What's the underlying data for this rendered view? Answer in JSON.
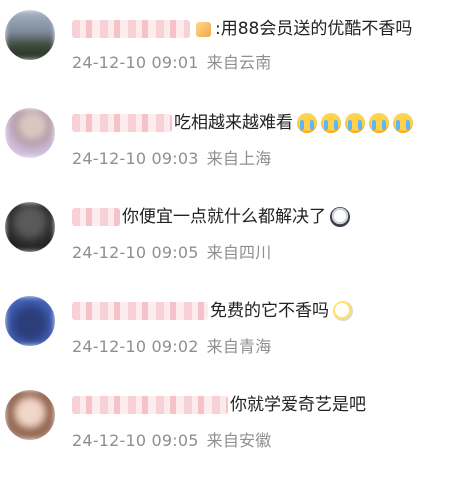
{
  "comments": [
    {
      "content": "用88会员送的优酷不香吗",
      "prefix": ":",
      "time": "24-12-10 09:01",
      "source": "来自云南"
    },
    {
      "content": "吃相越来越难看",
      "emojis": [
        "cry-emoji",
        "cry-emoji",
        "cry-emoji",
        "cry-emoji",
        "cry-emoji"
      ],
      "time": "24-12-10 09:03",
      "source": "来自上海"
    },
    {
      "content": "你便宜一点就什么都解决了",
      "time": "24-12-10 09:05",
      "source": "来自四川"
    },
    {
      "content": "免费的它不香吗",
      "time": "24-12-10 09:02",
      "source": "来自青海"
    },
    {
      "content": "你就学爱奇艺是吧",
      "time": "24-12-10 09:05",
      "source": "来自安徽"
    }
  ],
  "colors": {
    "meta_text": "#8f8f8f",
    "content_text": "#222222",
    "name_blur": "#f6c9cf"
  }
}
